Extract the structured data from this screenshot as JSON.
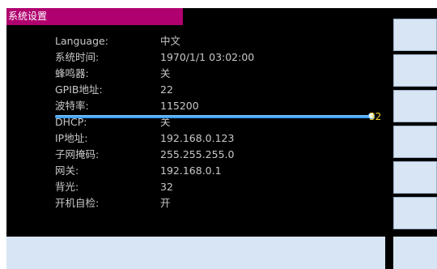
{
  "window": {
    "title": "系统设置"
  },
  "settings": [
    {
      "label": "Language:",
      "value": "中文"
    },
    {
      "label": "系统时间:",
      "value": "1970/1/1 03:02:00"
    },
    {
      "label": "蜂鸣器:",
      "value": "关"
    },
    {
      "label": "GPIB地址:",
      "value": "22"
    },
    {
      "label": "波特率:",
      "value": "115200"
    },
    {
      "label": "DHCP:",
      "value": "关"
    },
    {
      "label": "IP地址:",
      "value": "192.168.0.123"
    },
    {
      "label": "子网掩码:",
      "value": "255.255.255.0"
    },
    {
      "label": "网关:",
      "value": "192.168.0.1"
    },
    {
      "label": "背光:",
      "value": "32"
    },
    {
      "label": "开机自检:",
      "value": "开"
    }
  ],
  "backlight_slider": {
    "value": "32",
    "level": 1.0
  },
  "colors": {
    "title_bg": "#b0006f",
    "panel_bg": "#000000",
    "text": "#c8c8c8",
    "slider": "#2a8ee8",
    "slider_value": "#f2d12a",
    "softkey_bg": "#d7e5f4"
  }
}
